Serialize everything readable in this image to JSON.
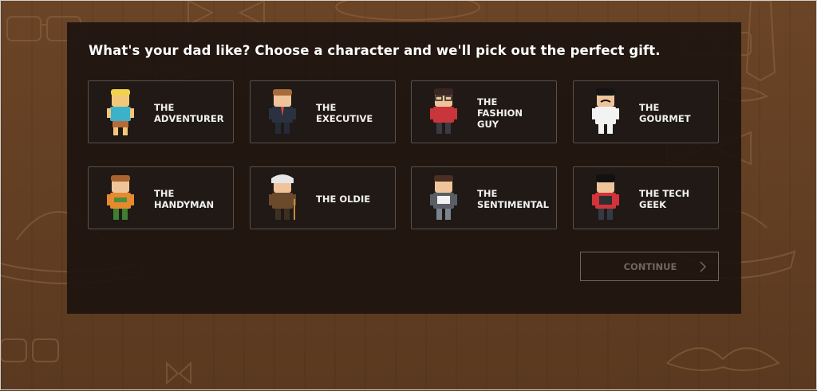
{
  "headline": "What's your dad like? Choose a character and we'll pick out the perfect gift.",
  "characters": [
    {
      "name": "THE\nADVENTURER",
      "icon": "adventurer-avatar-icon"
    },
    {
      "name": "THE\nEXECUTIVE",
      "icon": "executive-avatar-icon"
    },
    {
      "name": "THE\nFASHION\nGUY",
      "icon": "fashion-guy-avatar-icon"
    },
    {
      "name": "THE\nGOURMET",
      "icon": "gourmet-avatar-icon"
    },
    {
      "name": "THE\nHANDYMAN",
      "icon": "handyman-avatar-icon"
    },
    {
      "name": "THE OLDIE",
      "icon": "oldie-avatar-icon"
    },
    {
      "name": "THE\nSENTIMENTAL",
      "icon": "sentimental-avatar-icon"
    },
    {
      "name": "THE TECH\nGEEK",
      "icon": "tech-geek-avatar-icon"
    }
  ],
  "continue_label": "CONTINUE",
  "continue_icon": "chevron-right-icon",
  "colors": {
    "background": "#5a3a22",
    "panel": "#1c140f",
    "card_border": "#5b5147",
    "disabled": "#6f6760"
  }
}
